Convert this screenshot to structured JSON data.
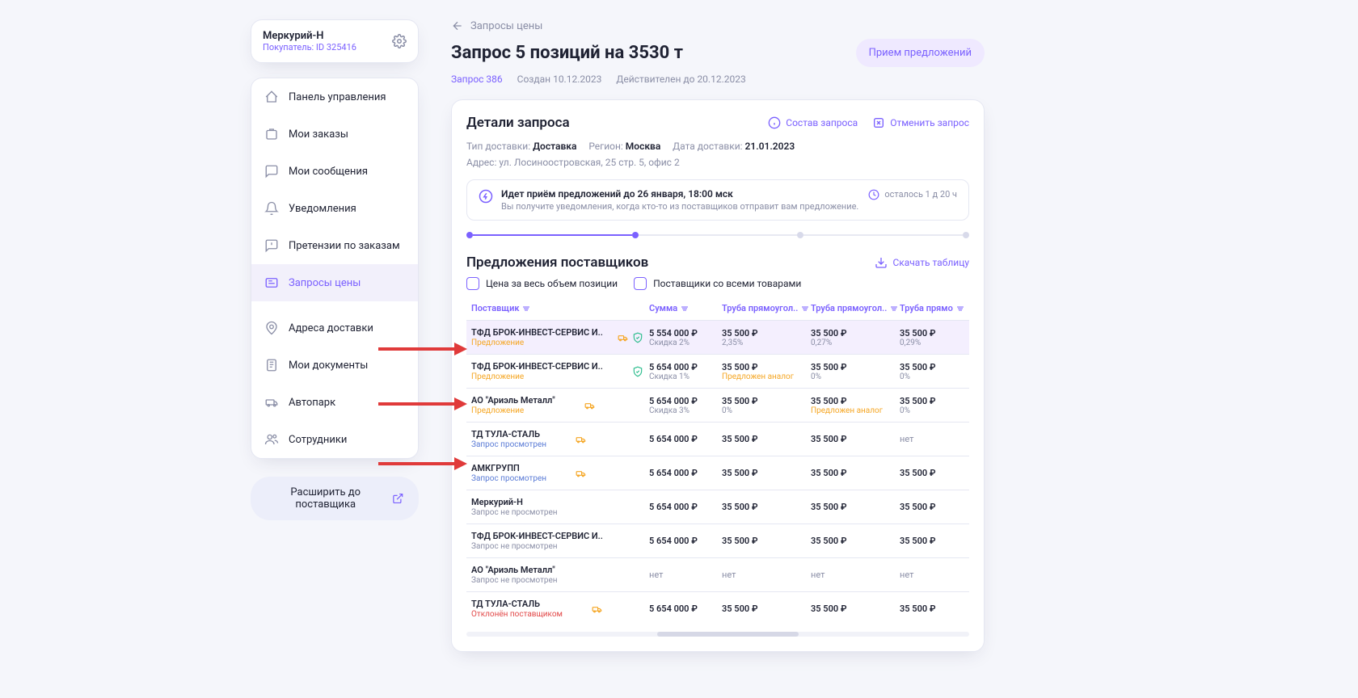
{
  "profile": {
    "name": "Меркурий-Н",
    "sub": "Покупатель: ID 325416"
  },
  "menu": [
    {
      "key": "dashboard",
      "label": "Панель управления"
    },
    {
      "key": "orders",
      "label": "Мои заказы"
    },
    {
      "key": "messages",
      "label": "Мои сообщения"
    },
    {
      "key": "notifications",
      "label": "Уведомления"
    },
    {
      "key": "claims",
      "label": "Претензии по заказам"
    },
    {
      "key": "quotes",
      "label": "Запросы цены",
      "active": true
    },
    {
      "key": "addresses",
      "label": "Адреса доставки"
    },
    {
      "key": "documents",
      "label": "Мои документы"
    },
    {
      "key": "fleet",
      "label": "Автопарк"
    },
    {
      "key": "staff",
      "label": "Сотрудники"
    }
  ],
  "expand_btn": "Расширить до поставщика",
  "back": "Запросы цены",
  "title": "Запрос 5 позиций на 3530 т",
  "status_pill": "Прием предложений",
  "meta": {
    "id": "Запрос 386",
    "created": "Создан 10.12.2023",
    "valid": "Действителен до 20.12.2023"
  },
  "details": {
    "heading": "Детали запроса",
    "actions": {
      "compose": "Состав запроса",
      "cancel": "Отменить запрос"
    },
    "delivery_type_label": "Тип доставки: ",
    "delivery_type": "Доставка",
    "region_label": "Регион: ",
    "region": "Москва",
    "date_label": "Дата доставки: ",
    "date": "21.01.2023",
    "address_label": "Адрес: ",
    "address": "ул. Лосиноостровская, 25 стр. 5, офис 2",
    "notice_title": "Идет приём предложений до 26 января, 18:00 мск",
    "notice_sub": "Вы получите уведомления, когда кто-то из поставщиков отправит вам предложение.",
    "remaining": "осталось 1 д 20 ч"
  },
  "offers": {
    "heading": "Предложения поставщиков",
    "download": "Скачать таблицу",
    "filter1": "Цена за весь объем позиции",
    "filter2": "Поставщики со всеми товарами",
    "columns": [
      "Поставщик",
      "Сумма",
      "Труба прямоугол..",
      "Труба прямоугол..",
      "Труба прямо"
    ],
    "rows": [
      {
        "name": "ТФД БРОК-ИНВЕСТ-СЕРВИС И..",
        "status": "Предложение",
        "status_cls": "st-offer",
        "icons": [
          "delivery",
          "shield"
        ],
        "hl": true,
        "sum": "5 554 000 ₽",
        "sum_sub": "Скидка 2%",
        "c1": "35 500 ₽",
        "c1s": "2,35%",
        "c2": "35 500 ₽",
        "c2s": "0,27%",
        "c3": "35 500 ₽",
        "c3s": "0,29%"
      },
      {
        "name": "ТФД БРОК-ИНВЕСТ-СЕРВИС И..",
        "status": "Предложение",
        "status_cls": "st-offer",
        "icons": [
          "shield"
        ],
        "sum": "5 654 000 ₽",
        "sum_sub": "Скидка 1%",
        "c1": "35 500 ₽",
        "c1s": "Предложен аналог",
        "c1sc": "orange",
        "c2": "35 500 ₽",
        "c2s": "0%",
        "c3": "35 500 ₽",
        "c3s": "0%"
      },
      {
        "name": "АО \"Ариэль Металл\"",
        "status": "Предложение",
        "status_cls": "st-offer",
        "icons": [
          "delivery"
        ],
        "sum": "5 654 000 ₽",
        "sum_sub": "Скидка 3%",
        "c1": "35 500 ₽",
        "c1s": "0%",
        "c2": "35 500 ₽",
        "c2s": "Предложен аналог",
        "c2sc": "orange",
        "c3": "35 500 ₽",
        "c3s": "0%"
      },
      {
        "name": "ТД ТУЛА-СТАЛЬ",
        "status": "Запрос просмотрен",
        "status_cls": "st-view",
        "icons": [
          "delivery"
        ],
        "sum": "5 654 000 ₽",
        "c1": "35 500 ₽",
        "c2": "35 500 ₽",
        "c3": "нет",
        "c3no": true
      },
      {
        "name": "АМКГРУПП",
        "status": "Запрос просмотрен",
        "status_cls": "st-view",
        "icons": [
          "delivery"
        ],
        "sum": "5 654 000 ₽",
        "c1": "35 500 ₽",
        "c2": "35 500 ₽",
        "c3": "35 500 ₽"
      },
      {
        "name": "Меркурий-Н",
        "status": "Запрос не просмотрен",
        "status_cls": "st-new",
        "icons": [],
        "sum": "5 654 000 ₽",
        "c1": "35 500 ₽",
        "c2": "35 500 ₽",
        "c3": "35 500 ₽"
      },
      {
        "name": "ТФД БРОК-ИНВЕСТ-СЕРВИС И..",
        "status": "Запрос не просмотрен",
        "status_cls": "st-new",
        "icons": [],
        "sum": "5 654 000 ₽",
        "c1": "35 500 ₽",
        "c2": "35 500 ₽",
        "c3": "35 500 ₽"
      },
      {
        "name": "АО \"Ариэль Металл\"",
        "status": "Запрос не просмотрен",
        "status_cls": "st-new",
        "icons": [],
        "sum": "нет",
        "sumno": true,
        "c1": "нет",
        "c1no": true,
        "c2": "нет",
        "c2no": true,
        "c3": "нет",
        "c3no": true
      },
      {
        "name": "ТД ТУЛА-СТАЛЬ",
        "status": "Отклонён поставщиком",
        "status_cls": "st-rej",
        "icons": [
          "delivery"
        ],
        "sum": "5 654 000 ₽",
        "c1": "35 500 ₽",
        "c2": "35 500 ₽",
        "c3": "35 500 ₽"
      }
    ]
  }
}
